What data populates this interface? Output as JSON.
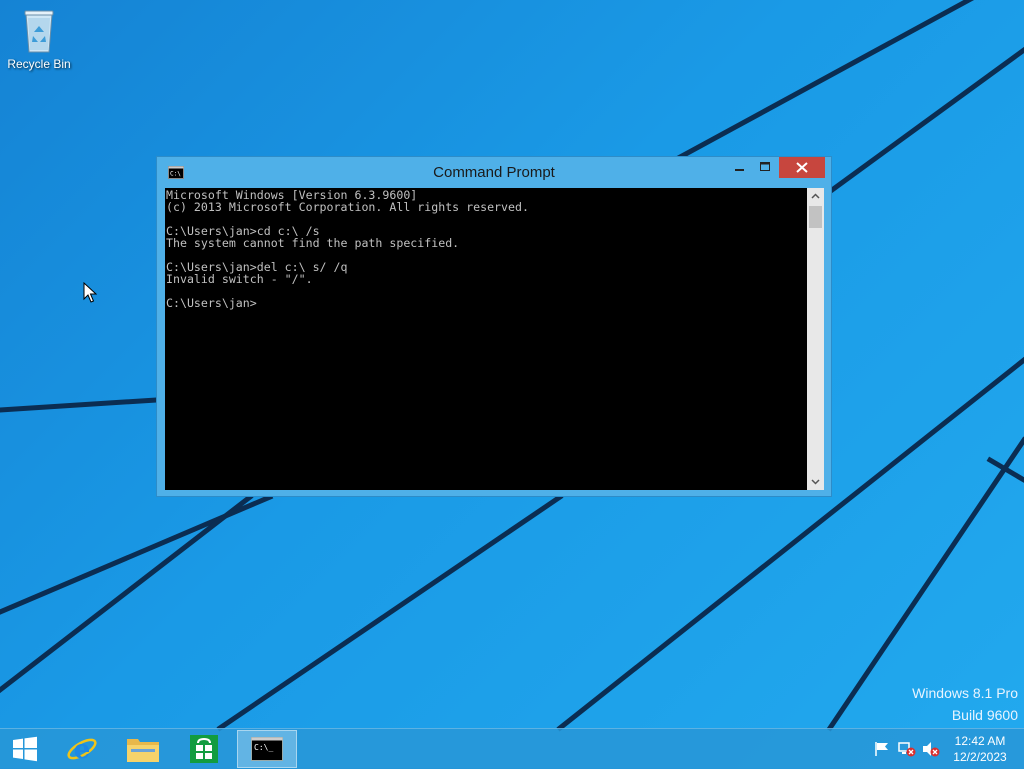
{
  "desktop": {
    "icons": [
      {
        "label": "Recycle Bin",
        "icon": "recycle-bin-icon"
      }
    ],
    "watermark": {
      "line1": "Windows 8.1 Pro",
      "line2": "Build 9600"
    }
  },
  "window": {
    "title": "Command Prompt",
    "icon": "cmd-icon",
    "buttons": [
      "minimize",
      "maximize",
      "close"
    ],
    "console_lines": [
      "Microsoft Windows [Version 6.3.9600]",
      "(c) 2013 Microsoft Corporation. All rights reserved.",
      "",
      "C:\\Users\\jan>cd c:\\ /s",
      "The system cannot find the path specified.",
      "",
      "C:\\Users\\jan>del c:\\ s/ /q",
      "Invalid switch - \"/\".",
      "",
      "C:\\Users\\jan>"
    ]
  },
  "taskbar": {
    "items": [
      {
        "name": "start",
        "icon": "windows-logo-icon"
      },
      {
        "name": "internet-explorer",
        "icon": "ie-icon"
      },
      {
        "name": "file-explorer",
        "icon": "folder-icon"
      },
      {
        "name": "store",
        "icon": "store-icon"
      },
      {
        "name": "command-prompt",
        "icon": "cmd-icon",
        "active": true
      }
    ],
    "tray": {
      "icons": [
        "action-center-flag-icon",
        "network-disconnected-icon",
        "volume-muted-icon"
      ],
      "time": "12:42 AM",
      "date": "12/2/2023"
    }
  },
  "colors": {
    "wallpaper": "#1a9ae6",
    "close_button": "#c7463e",
    "window_frame": "#4fb0e8",
    "console_bg": "#000000",
    "console_text": "#c0c0c0"
  }
}
